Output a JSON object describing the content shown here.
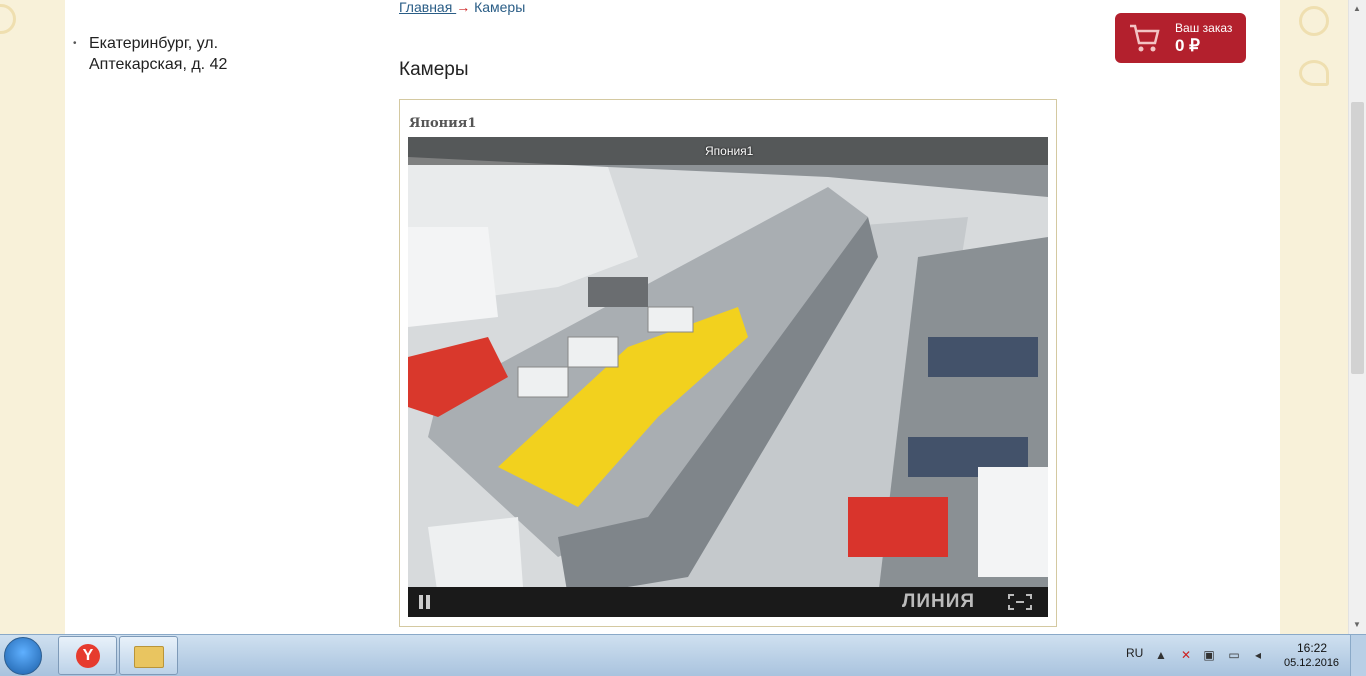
{
  "sidebar": {
    "address": "Екатеринбург, ул. Аптекарская, д. 42"
  },
  "breadcrumb": {
    "home": "Главная ",
    "separator": "→",
    "current": "Камеры"
  },
  "page_title": "Камеры",
  "camera": {
    "name": "Япония1",
    "overlay_caption": "Япония1",
    "brand": "ЛИНИЯ"
  },
  "cart": {
    "label": "Ваш заказ",
    "total": "0 ₽",
    "color": "#b3202d"
  },
  "taskbar": {
    "language": "RU",
    "time": "16:22",
    "date": "05.12.2016",
    "apps": [
      "yandex-browser",
      "file-explorer"
    ]
  }
}
